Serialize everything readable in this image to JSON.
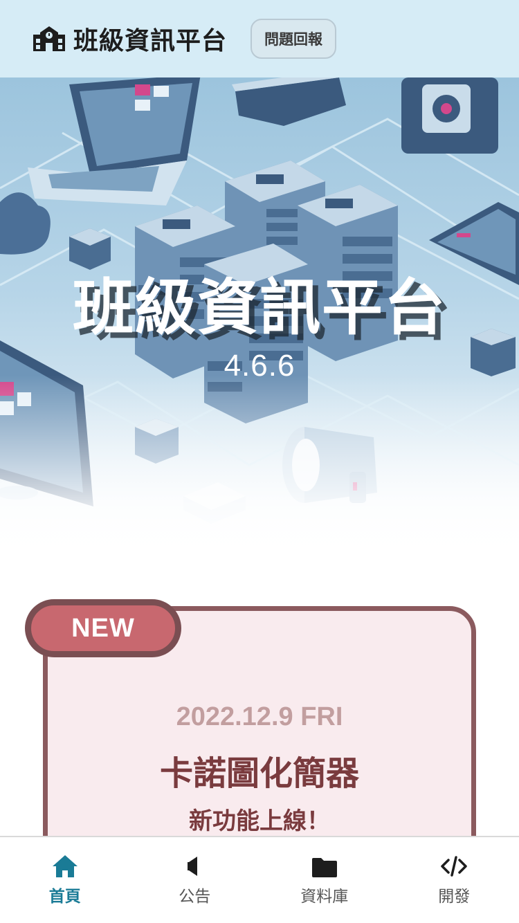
{
  "header": {
    "app_title": "班級資訊平台",
    "report_button": "問題回報"
  },
  "hero": {
    "title": "班級資訊平台",
    "version": "4.6.6"
  },
  "news_card": {
    "badge": "NEW",
    "date": "2022.12.9 FRI",
    "title": "卡諾圖化簡器",
    "subtitle": "新功能上線！"
  },
  "tabbar": {
    "items": [
      {
        "label": "首頁",
        "icon": "home-icon",
        "active": true
      },
      {
        "label": "公告",
        "icon": "megaphone-icon",
        "active": false
      },
      {
        "label": "資料庫",
        "icon": "folder-icon",
        "active": false
      },
      {
        "label": "開發",
        "icon": "code-icon",
        "active": false
      }
    ]
  },
  "colors": {
    "header_bg": "#d6ecf6",
    "card_bg": "#f9ebee",
    "card_border": "#8b5a5e",
    "badge_bg": "#c8686f",
    "accent_active": "#1a7b96"
  }
}
